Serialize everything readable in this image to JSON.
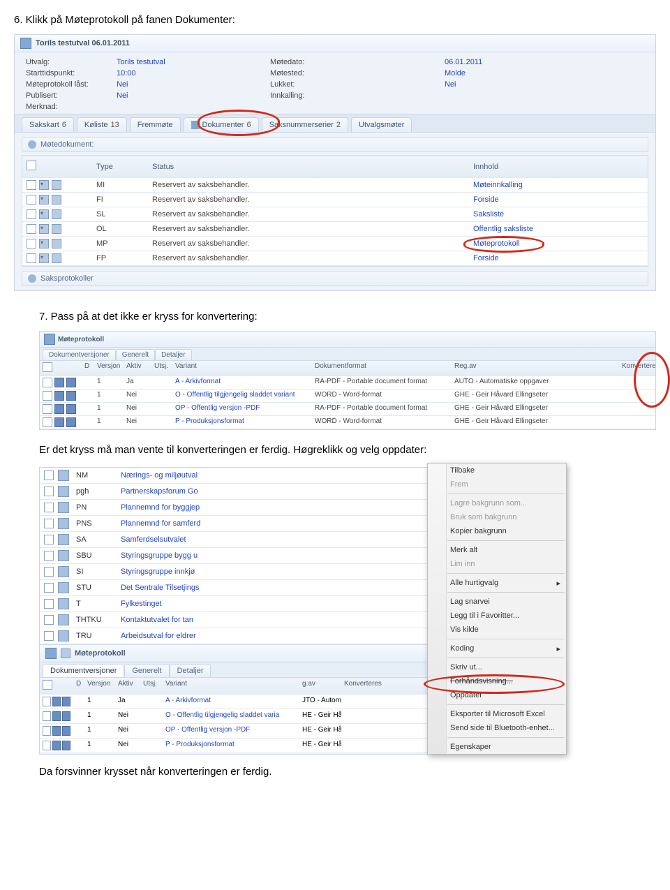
{
  "step6": {
    "heading": "6. Klikk på Møteprotokoll på fanen Dokumenter:"
  },
  "shot1": {
    "titlebar": "Torils testutval  06.01.2011",
    "info": {
      "utvalg_lbl": "Utvalg:",
      "utvalg_val": "Torils testutval",
      "motedato_lbl": "Møtedato:",
      "motedato_val": "06.01.2011",
      "start_lbl": "Starttidspunkt:",
      "start_val": "10:00",
      "motested_lbl": "Møtested:",
      "motested_val": "Molde",
      "last_lbl": "Møteprotokoll låst:",
      "last_val": "Nei",
      "lukket_lbl": "Lukket:",
      "lukket_val": "Nei",
      "pub_lbl": "Publisert:",
      "pub_val": "Nei",
      "innk_lbl": "Innkalling:",
      "innk_val": "",
      "merk_lbl": "Merknad:",
      "merk_val": ""
    },
    "tabs": [
      {
        "label": "Sakskart",
        "count": "6"
      },
      {
        "label": "Køliste",
        "count": "13"
      },
      {
        "label": "Fremmøte",
        "count": ""
      },
      {
        "label": "Dokumenter",
        "count": "6"
      },
      {
        "label": "Saksnummerserier",
        "count": "2"
      },
      {
        "label": "Utvalgsmøter",
        "count": ""
      }
    ],
    "section1": "Møtedokument:",
    "header": {
      "type": "Type",
      "status": "Status",
      "innhold": "Innhold"
    },
    "rows": [
      {
        "type": "MI",
        "status": "Reservert av saksbehandler.",
        "innhold": "Møteinnkalling"
      },
      {
        "type": "FI",
        "status": "Reservert av saksbehandler.",
        "innhold": "Forside"
      },
      {
        "type": "SL",
        "status": "Reservert av saksbehandler.",
        "innhold": "Saksliste"
      },
      {
        "type": "OL",
        "status": "Reservert av saksbehandler.",
        "innhold": "Offentlig saksliste"
      },
      {
        "type": "MP",
        "status": "Reservert av saksbehandler.",
        "innhold": "Møteprotokoll"
      },
      {
        "type": "FP",
        "status": "Reservert av saksbehandler.",
        "innhold": "Forside"
      }
    ],
    "section2": "Saksprotokoller"
  },
  "step7": {
    "heading": "7. Pass på at det ikke er kryss for konvertering:"
  },
  "shot2": {
    "title": "Møteprotokoll",
    "tabs": [
      "Dokumentversjoner",
      "Generelt",
      "Detaljer"
    ],
    "header": {
      "d": "D",
      "versjon": "Versjon",
      "aktiv": "Aktiv",
      "utsj": "Utsj.",
      "variant": "Variant",
      "format": "Dokumentformat",
      "regav": "Reg.av",
      "konv": "Konverteres"
    },
    "rows": [
      {
        "v": "1",
        "aktiv": "Ja",
        "variant": "A - Arkivformat",
        "format": "RA-PDF - Portable document format",
        "regav": "AUTO - Automatiske oppgaver"
      },
      {
        "v": "1",
        "aktiv": "Nei",
        "variant": "O - Offentlig tilgjengelig sladdet variant",
        "format": "WORD - Word-format",
        "regav": "GHE - Geir Håvard Ellingseter"
      },
      {
        "v": "1",
        "aktiv": "Nei",
        "variant": "OP - Offentlig versjon -PDF",
        "format": "RA-PDF - Portable document format",
        "regav": "GHE - Geir Håvard Ellingseter"
      },
      {
        "v": "1",
        "aktiv": "Nei",
        "variant": "P - Produksjonsformat",
        "format": "WORD - Word-format",
        "regav": "GHE - Geir Håvard Ellingseter"
      }
    ]
  },
  "mid_text": "Er det kryss må man vente til konverteringen er ferdig. Høgreklikk og velg oppdater:",
  "shot3": {
    "list": [
      {
        "code": "NM",
        "desc": "Nærings- og miljøutval"
      },
      {
        "code": "pgh",
        "desc": "Partnerskapsforum Go"
      },
      {
        "code": "PN",
        "desc": "Plannemnd for byggjep"
      },
      {
        "code": "PNS",
        "desc": "Plannemnd for samferd"
      },
      {
        "code": "SA",
        "desc": "Samferdselsutvalet"
      },
      {
        "code": "SBU",
        "desc": "Styringsgruppe bygg u"
      },
      {
        "code": "SI",
        "desc": "Styringsgruppe innkjø"
      },
      {
        "code": "STU",
        "desc": "Det Sentrale Tilsetjings"
      },
      {
        "code": "T",
        "desc": "Fylkestinget"
      },
      {
        "code": "THTKU",
        "desc": "Kontaktutvalet for tan"
      },
      {
        "code": "TRU",
        "desc": "Arbeidsutval for eldrer"
      }
    ],
    "divider_title": "Møteprotokoll",
    "tabs": [
      "Dokumentversjoner",
      "Generelt",
      "Detaljer"
    ],
    "vhdr": {
      "d": "D",
      "versjon": "Versjon",
      "aktiv": "Aktiv",
      "utsj": "Utsj.",
      "variant": "Variant",
      "gav": "g.av",
      "konv": "Konverteres"
    },
    "vrows": [
      {
        "v": "1",
        "aktiv": "Ja",
        "variant": "A - Arkivformat",
        "gav": "JTO - Automatiske oppgaver"
      },
      {
        "v": "1",
        "aktiv": "Nei",
        "variant": "O - Offentlig tilgjengelig sladdet varia",
        "gav": "HE - Geir Håvard Ellingseter"
      },
      {
        "v": "1",
        "aktiv": "Nei",
        "variant": "OP - Offentlig versjon -PDF",
        "gav": "HE - Geir Håvard Ellingseter"
      },
      {
        "v": "1",
        "aktiv": "Nei",
        "variant": "P - Produksjonsformat",
        "gav": "HE - Geir Håvard Ellingseter"
      }
    ]
  },
  "ctxmenu": {
    "items": [
      {
        "label": "Tilbake",
        "disabled": false
      },
      {
        "label": "Frem",
        "disabled": true
      },
      {
        "sep": true
      },
      {
        "label": "Lagre bakgrunn som...",
        "disabled": true
      },
      {
        "label": "Bruk som bakgrunn",
        "disabled": true
      },
      {
        "label": "Kopier bakgrunn",
        "disabled": false
      },
      {
        "sep": true
      },
      {
        "label": "Merk alt",
        "disabled": false
      },
      {
        "label": "Lim inn",
        "disabled": true
      },
      {
        "sep": true
      },
      {
        "label": "Alle hurtigvalg",
        "arrow": true
      },
      {
        "sep": true
      },
      {
        "label": "Lag snarvei"
      },
      {
        "label": "Legg til i Favoritter..."
      },
      {
        "label": "Vis kilde"
      },
      {
        "sep": true
      },
      {
        "label": "Koding",
        "arrow": true
      },
      {
        "sep": true
      },
      {
        "label": "Skriv ut..."
      },
      {
        "label": "Forhåndsvisning...",
        "strike": true
      },
      {
        "label": "Oppdater"
      },
      {
        "sep": true
      },
      {
        "label": "Eksporter til Microsoft Excel"
      },
      {
        "label": "Send side til Bluetooth-enhet..."
      },
      {
        "sep": true
      },
      {
        "label": "Egenskaper"
      }
    ]
  },
  "footer": "Da forsvinner krysset når konverteringen er ferdig."
}
